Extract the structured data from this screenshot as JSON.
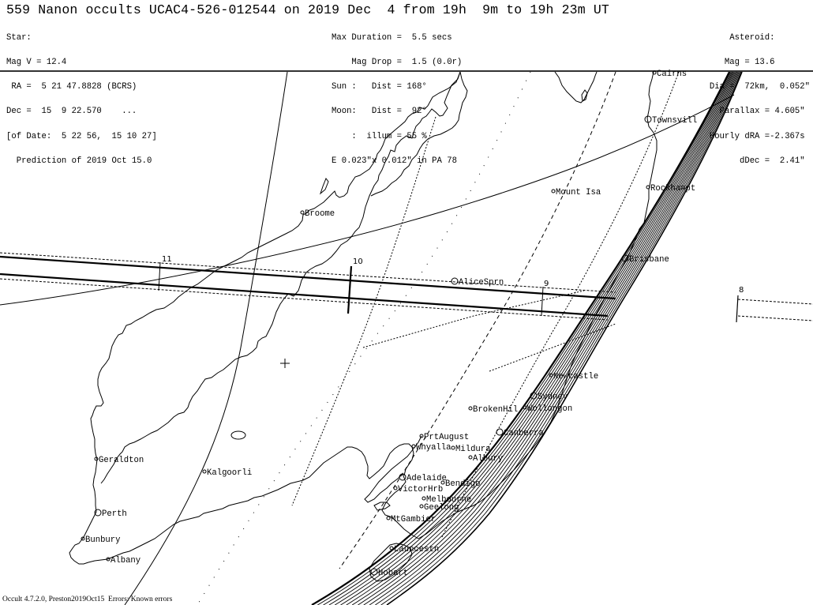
{
  "title": "559 Nanon occults UCAC4-526-012544 on 2019 Dec  4 from 19h  9m to 19h 23m UT",
  "star": {
    "lines": [
      "Star:",
      "Mag V = 12.4",
      " RA =  5 21 47.8828 (BCRS)",
      "Dec =  15  9 22.570    ...",
      "[of Date:  5 22 56,  15 10 27]",
      "  Prediction of 2019 Oct 15.0"
    ]
  },
  "event": {
    "lines": [
      "Max Duration =  5.5 secs",
      "    Mag Drop =  1.5 (0.0r)",
      "Sun :   Dist = 168°",
      "Moon:   Dist =  92°",
      "    :  illum = 55 %",
      "E 0.023\"x 0.012\" in PA 78"
    ]
  },
  "asteroid": {
    "lines": [
      "Asteroid:       ",
      "Mag = 13.6       ",
      "Dia =  72km,  0.052\"",
      "Parallax = 4.605\" ",
      "Hourly dRA =-2.367s ",
      "dDec =  2.41\" "
    ]
  },
  "map": {
    "time_ticks": [
      {
        "label": "11"
      },
      {
        "label": "10"
      },
      {
        "label": "9"
      },
      {
        "label": "8"
      }
    ],
    "cities": [
      {
        "name": "Cairns"
      },
      {
        "name": "Townsvill"
      },
      {
        "name": "Mount Isa"
      },
      {
        "name": "Rockhampt"
      },
      {
        "name": "Broome"
      },
      {
        "name": "Brisbane"
      },
      {
        "name": "AliceSprn"
      },
      {
        "name": "Newcastle"
      },
      {
        "name": "Sydney"
      },
      {
        "name": "BrokenHil"
      },
      {
        "name": "Wollongon"
      },
      {
        "name": "Canberra"
      },
      {
        "name": "PrtAugust"
      },
      {
        "name": "Whyalla"
      },
      {
        "name": "Mildura"
      },
      {
        "name": "Albury"
      },
      {
        "name": "Geraldton"
      },
      {
        "name": "Kalgoorli"
      },
      {
        "name": "Adelaide"
      },
      {
        "name": "Bendigo"
      },
      {
        "name": "VictorHrb"
      },
      {
        "name": "Melbourne"
      },
      {
        "name": "Geelong"
      },
      {
        "name": "Perth"
      },
      {
        "name": "MtGambier"
      },
      {
        "name": "Bunbury"
      },
      {
        "name": "Launcestn"
      },
      {
        "name": "Albany"
      },
      {
        "name": "Hobart"
      }
    ]
  },
  "footer": "Occult 4.7.2.0, Preston2019Oct15  Errors: Known errors"
}
